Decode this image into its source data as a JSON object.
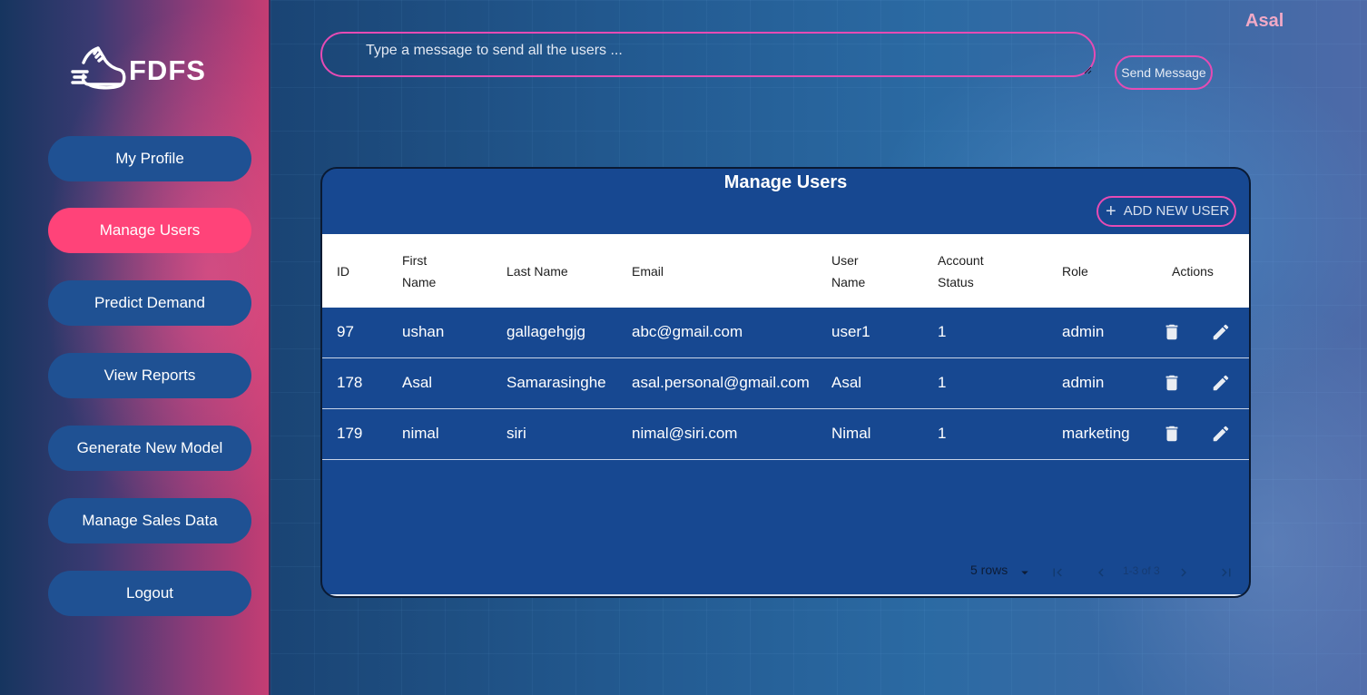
{
  "app": {
    "logo_text": "FDFS",
    "user_name": "Asal"
  },
  "sidebar": {
    "items": [
      {
        "label": "My Profile",
        "active": false
      },
      {
        "label": "Manage Users",
        "active": true
      },
      {
        "label": "Predict Demand",
        "active": false
      },
      {
        "label": "View Reports",
        "active": false
      },
      {
        "label": "Generate New Model",
        "active": false
      },
      {
        "label": "Manage Sales Data",
        "active": false
      },
      {
        "label": "Logout",
        "active": false
      }
    ]
  },
  "message": {
    "placeholder": "Type a message to send all the users ...",
    "value": "",
    "send_label": "Send Message"
  },
  "table": {
    "title": "Manage Users",
    "add_label": "ADD NEW USER",
    "columns": [
      "ID",
      "First Name",
      "Last Name",
      "Email",
      "User Name",
      "Account Status",
      "Role",
      "Actions"
    ],
    "rows": [
      [
        "97",
        "ushan",
        "gallagehgjg",
        "abc@gmail.com",
        "user1",
        "1",
        "admin"
      ],
      [
        "178",
        "Asal",
        "Samarasinghe",
        "asal.personal@gmail.com",
        "Asal",
        "1",
        "admin"
      ],
      [
        "179",
        "nimal",
        "siri",
        "nimal@siri.com",
        "Nimal",
        "1",
        "marketing"
      ]
    ],
    "pagination": {
      "rows_per_page": "5 rows",
      "range": "1-3 of 3"
    }
  },
  "colors": {
    "accent": "#ff4379",
    "nav_button": "#1f5193",
    "outline_pink": "#e64bb4",
    "table_bg": "#174891"
  },
  "icons": [
    "shoe-logo-icon",
    "delete-icon",
    "edit-icon",
    "plus-icon",
    "dropdown-arrow-icon",
    "first-page-icon",
    "prev-page-icon",
    "next-page-icon",
    "last-page-icon"
  ]
}
